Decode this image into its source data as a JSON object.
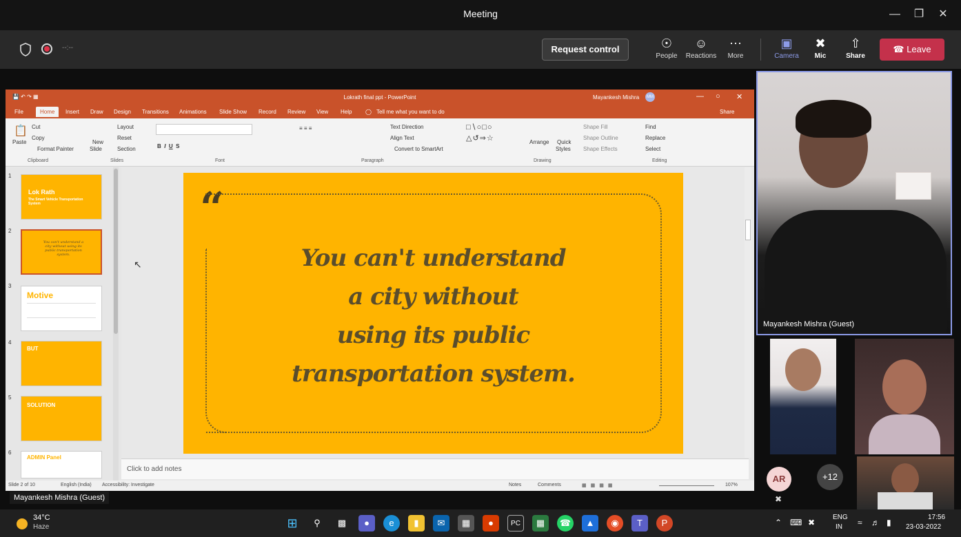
{
  "window": {
    "title": "Meeting"
  },
  "toolbar": {
    "request_control": "Request control",
    "people": "People",
    "reactions": "Reactions",
    "more": "More",
    "camera": "Camera",
    "mic": "Mic",
    "share": "Share",
    "leave": "Leave"
  },
  "ppt": {
    "title": "Lokrath final ppt - PowerPoint",
    "user": "Mayankesh Mishra",
    "user_initials": "MM",
    "share": "Share",
    "tell_me": "Tell me what you want to do",
    "tabs": [
      "File",
      "Home",
      "Insert",
      "Draw",
      "Design",
      "Transitions",
      "Animations",
      "Slide Show",
      "Record",
      "Review",
      "View",
      "Help"
    ],
    "ribbon": {
      "cut": "Cut",
      "copy": "Copy",
      "format_painter": "Format Painter",
      "paste": "Paste",
      "new_slide": "New",
      "new_slide2": "Slide",
      "layout": "Layout",
      "reset": "Reset",
      "section": "Section",
      "text_direction": "Text Direction",
      "align_text": "Align Text",
      "convert_smartart": "Convert to SmartArt",
      "arrange": "Arrange",
      "quick_styles": "Quick",
      "quick_styles2": "Styles",
      "shape_fill": "Shape Fill",
      "shape_outline": "Shape Outline",
      "shape_effects": "Shape Effects",
      "find": "Find",
      "replace": "Replace",
      "select": "Select",
      "groups": [
        "Clipboard",
        "Slides",
        "Font",
        "Paragraph",
        "Drawing",
        "Editing"
      ]
    },
    "thumbnails": [
      {
        "num": "1",
        "title": "Lok Rath",
        "subtitle": "The Smart Vehicle Transportation System"
      },
      {
        "num": "2",
        "title": "You can't understand a city without using its public transportation system."
      },
      {
        "num": "3",
        "title": "Motive"
      },
      {
        "num": "4",
        "title": "BUT"
      },
      {
        "num": "5",
        "title": "SOLUTION"
      },
      {
        "num": "6",
        "title": "ADMIN Panel"
      }
    ],
    "slide_lines": [
      "You can't understand",
      "a city without",
      "using its public",
      "transportation system."
    ],
    "quote_mark": "“",
    "notes_placeholder": "Click to add notes",
    "status": {
      "slide": "Slide 2 of 10",
      "lang": "English (India)",
      "accessibility": "Accessibility: Investigate",
      "notes": "Notes",
      "comments": "Comments",
      "zoom": "107%"
    }
  },
  "participants": {
    "main_name": "Mayankesh Mishra (Guest)",
    "avatar_initials": "AR",
    "extra_count": "+12",
    "presenter_label": "Mayankesh Mishra (Guest)"
  },
  "taskbar": {
    "temp": "34°C",
    "weather": "Haze",
    "lang1": "ENG",
    "lang2": "IN",
    "time": "17:56",
    "date": "23-03-2022"
  },
  "colors": {
    "ppt_accent": "#c9522a",
    "slide_bg": "#ffb400",
    "leave_red": "#c4314b"
  }
}
